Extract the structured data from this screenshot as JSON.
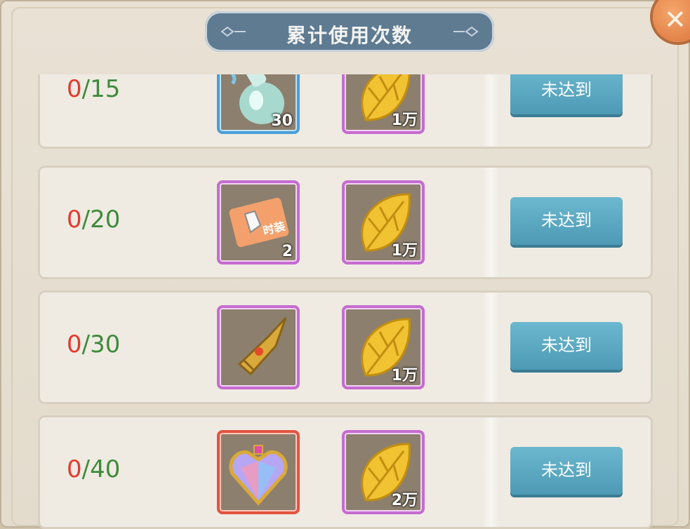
{
  "dialog": {
    "title": "累计使用次数",
    "close_icon": "close-x-icon"
  },
  "rows": [
    {
      "current": "0",
      "target": "/15",
      "reward1": {
        "icon": "potion-bottle-icon",
        "frame": "blue",
        "qty": "30"
      },
      "reward2": {
        "icon": "gold-leaf-icon",
        "frame": "purple",
        "qty": "1万"
      },
      "button": "未达到"
    },
    {
      "current": "0",
      "target": "/20",
      "reward1": {
        "icon": "fashion-card-icon",
        "frame": "purple",
        "qty": "2",
        "card_text": "时装"
      },
      "reward2": {
        "icon": "gold-leaf-icon",
        "frame": "purple",
        "qty": "1万"
      },
      "button": "未达到"
    },
    {
      "current": "0",
      "target": "/30",
      "reward1": {
        "icon": "golden-horn-icon",
        "frame": "purple",
        "qty": ""
      },
      "reward2": {
        "icon": "gold-leaf-icon",
        "frame": "purple",
        "qty": "1万"
      },
      "button": "未达到"
    },
    {
      "current": "0",
      "target": "/40",
      "reward1": {
        "icon": "crystal-heart-icon",
        "frame": "red",
        "qty": ""
      },
      "reward2": {
        "icon": "gold-leaf-icon",
        "frame": "purple",
        "qty": "2万"
      },
      "button": "未达到"
    }
  ]
}
